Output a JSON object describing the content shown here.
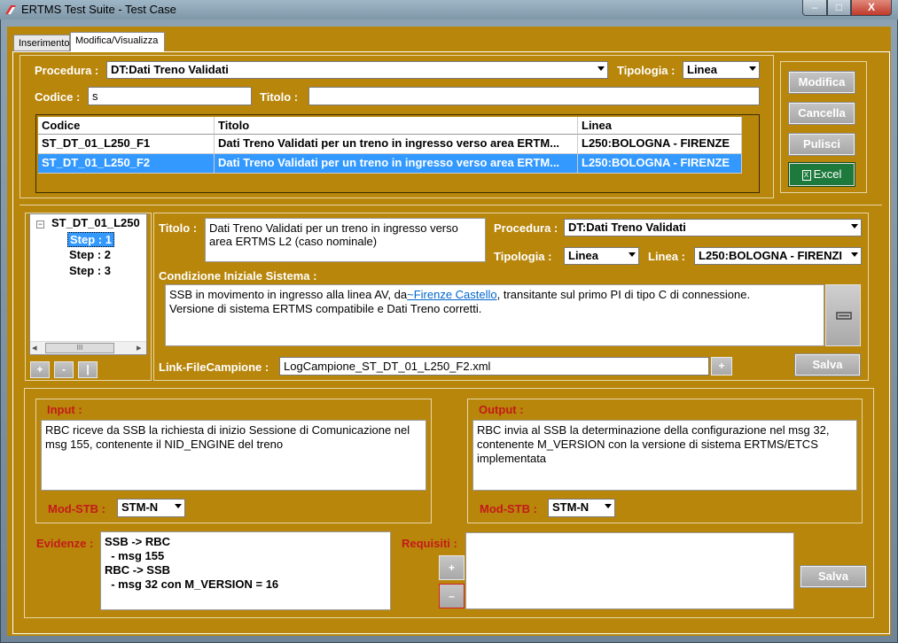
{
  "window": {
    "title": "ERTMS Test Suite - Test Case",
    "min_glyph": "–",
    "max_glyph": "□",
    "close_glyph": "X"
  },
  "tabs": [
    {
      "label": "Inserimento"
    },
    {
      "label": "Modifica/Visualizza"
    }
  ],
  "search": {
    "procedura_label": "Procedura :",
    "procedura_value": "DT:Dati Treno Validati",
    "tipologia_label": "Tipologia :",
    "tipologia_value": "Linea",
    "codice_label": "Codice :",
    "codice_value": "s",
    "titolo_label": "Titolo :",
    "titolo_value": ""
  },
  "buttons": {
    "modifica": "Modifica",
    "cancella": "Cancella",
    "pulisci": "Pulisci",
    "excel": "Excel",
    "salva": "Salva",
    "salva2": "Salva",
    "plus": "+",
    "minus": "-",
    "pipe": "|",
    "link_plus": "+",
    "req_plus": "+",
    "req_minus": "–"
  },
  "grid": {
    "headers": [
      "Codice",
      "Titolo",
      "Linea"
    ],
    "rows": [
      {
        "codice": "ST_DT_01_L250_F1",
        "titolo": "Dati Treno Validati per un treno in ingresso verso area ERTM...",
        "linea": "L250:BOLOGNA - FIRENZE"
      },
      {
        "codice": "ST_DT_01_L250_F2",
        "titolo": "Dati Treno Validati per un treno in ingresso verso area ERTM...",
        "linea": "L250:BOLOGNA - FIRENZE"
      }
    ]
  },
  "tree": {
    "root": "ST_DT_01_L250",
    "expander": "−",
    "steps": [
      "Step : 1",
      "Step : 2",
      "Step : 3"
    ],
    "scroll_left": "◂",
    "scroll_right": "▸",
    "scroll_grip": "III"
  },
  "detail": {
    "titolo_label": "Titolo :",
    "titolo_value": "Dati Treno Validati per un treno in ingresso verso area ERTMS L2 (caso nominale)",
    "procedura_label": "Procedura :",
    "procedura_value": "DT:Dati Treno Validati",
    "tipologia_label": "Tipologia :",
    "tipologia_value": "Linea",
    "linea_label": "Linea :",
    "linea_value": "L250:BOLOGNA - FIRENZI",
    "condizione_label": "Condizione Iniziale Sistema :",
    "condizione_pre": "SSB in movimento in ingresso alla linea AV, da",
    "condizione_link": "~Firenze Castello",
    "condizione_post": ", transitante sul primo PI di tipo C di connessione.",
    "condizione_line2": "Versione di sistema ERTMS compatibile e Dati Treno corretti.",
    "link_label": "Link-FileCampione :",
    "link_value": "LogCampione_ST_DT_01_L250_F2.xml"
  },
  "step": {
    "input_label": "Input :",
    "input_text": "RBC riceve da SSB la richiesta di inizio Sessione di Comunicazione nel msg 155, contenente il NID_ENGINE del treno",
    "output_label": "Output :",
    "output_text": "RBC invia al SSB la determinazione della configurazione nel msg 32, contenente M_VERSION con la versione di sistema ERTMS/ETCS implementata",
    "modstb_label": "Mod-STB :",
    "modstb_in_value": "STM-N",
    "modstb_out_value": "STM-N",
    "evidenze_label": "Evidenze :",
    "evidenze_lines": [
      "SSB -> RBC",
      "  - msg 155",
      "RBC -> SSB",
      "  - msg 32 con M_VERSION = 16"
    ],
    "requisiti_label": "Requisiti :"
  }
}
